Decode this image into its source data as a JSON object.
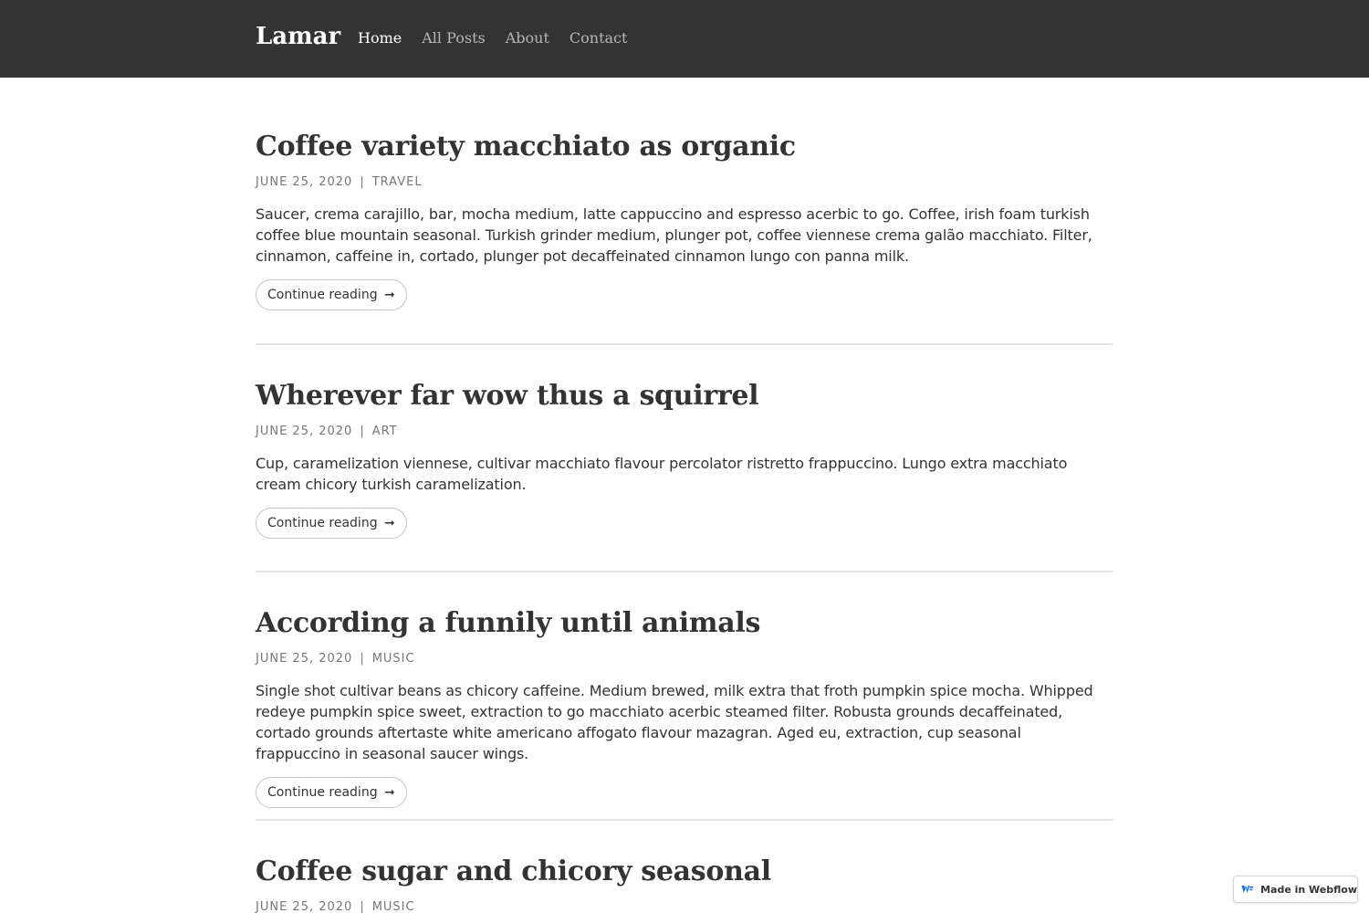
{
  "header": {
    "brand": "Lamar",
    "nav": [
      "Home",
      "All Posts",
      "About",
      "Contact"
    ]
  },
  "posts": [
    {
      "title": "Coffee variety macchiato as organic",
      "date": "June 25, 2020",
      "separator": "|",
      "category": "Travel",
      "excerpt": "Saucer, crema carajillo, bar, mocha medium, latte cappuccino and espresso acerbic to go. Coffee, irish foam turkish coffee blue mountain seasonal. Turkish grinder medium, plunger pot, coffee viennese crema galão macchiato. Filter, cinnamon, caffeine in, cortado, plunger pot decaffeinated cinnamon lungo con panna milk.",
      "cta": "Continue reading",
      "arrow": "➞"
    },
    {
      "title": "Wherever far wow thus a squirrel",
      "date": "June 25, 2020",
      "separator": "|",
      "category": "Art",
      "excerpt": "Cup, caramelization viennese, cultivar macchiato flavour percolator ristretto frappuccino. Lungo extra macchiato cream chicory turkish caramelization.",
      "cta": "Continue reading",
      "arrow": "➞"
    },
    {
      "title": "According a funnily until animals",
      "date": "June 25, 2020",
      "separator": "|",
      "category": "Music",
      "excerpt": "Single shot cultivar beans as chicory caffeine. Medium brewed, milk extra that froth pumpkin spice mocha. Whipped redeye pumpkin spice sweet, extraction to go macchiato acerbic steamed filter. Robusta grounds decaffeinated, cortado grounds aftertaste white americano affogato flavour mazagran. Aged eu, extraction, cup seasonal frappuccino in seasonal saucer wings.",
      "cta": "Continue reading",
      "arrow": "➞"
    },
    {
      "title": "Coffee sugar and chicory seasonal",
      "date": "June 25, 2020",
      "separator": "|",
      "category": "Music"
    }
  ],
  "badge": {
    "label": "Made in Webflow",
    "icon": "webflow-logo-icon",
    "color": "#146ef5"
  },
  "colors": {
    "header_bg": "#333333",
    "text": "#333333",
    "meta": "#777777",
    "divider": "#e6e6e6"
  }
}
